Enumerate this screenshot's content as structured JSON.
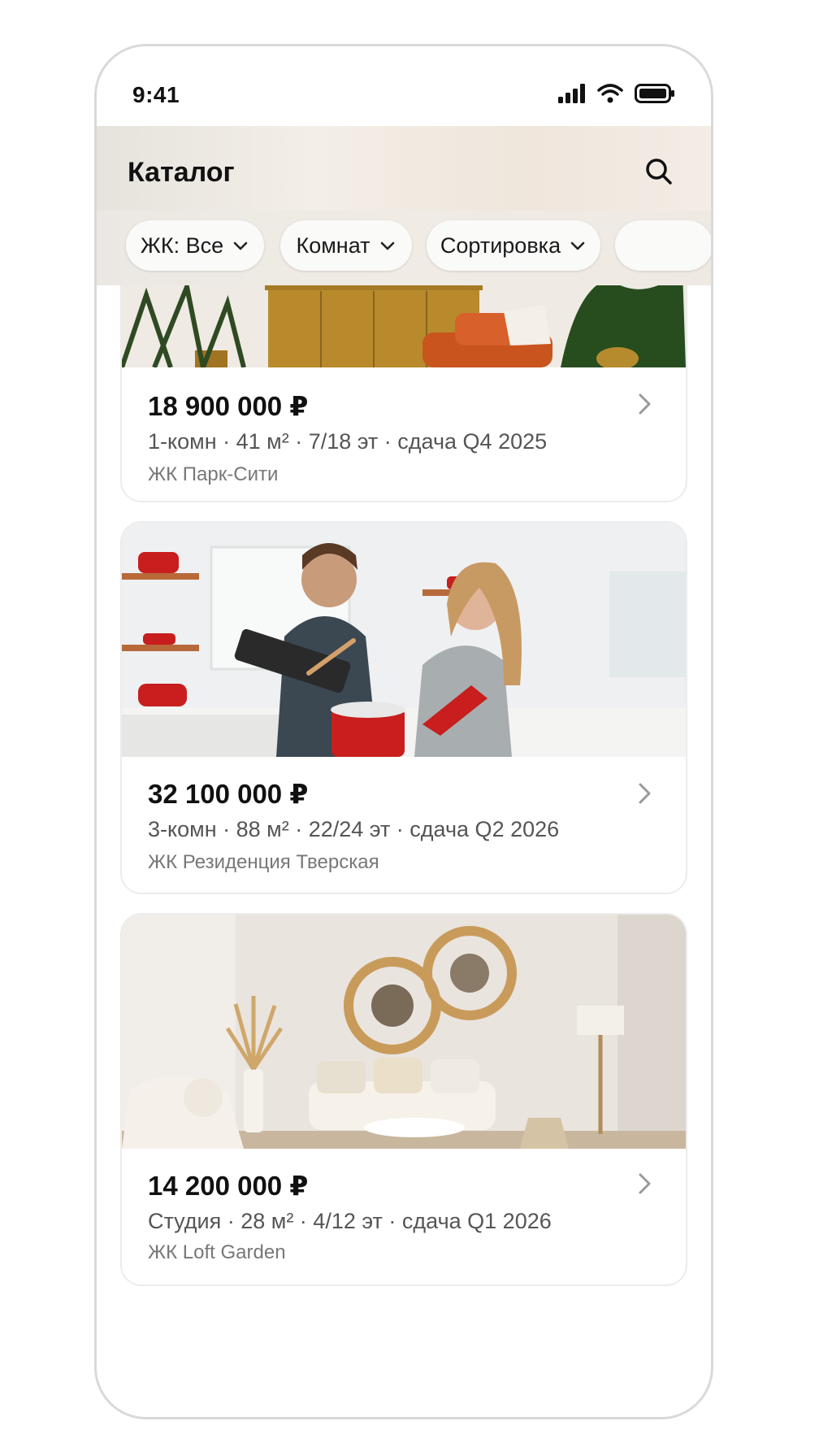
{
  "status": {
    "time": "9:41"
  },
  "header": {
    "title": "Каталог"
  },
  "filters": [
    {
      "label": "ЖК: Все"
    },
    {
      "label": "Комнат"
    },
    {
      "label": "Сортировка"
    }
  ],
  "listings": [
    {
      "price": "18 900 000 ₽",
      "specs": "1-комн · 41 м² · 7/18 эт · сдача Q4 2025",
      "complex": "ЖК Парк-Сити"
    },
    {
      "price": "32 100 000 ₽",
      "specs": "3-комн · 88 м² · 22/24 эт · сдача Q2 2026",
      "complex": "ЖК Резиденция Тверская"
    },
    {
      "price": "14 200 000 ₽",
      "specs": "Студия · 28 м² · 4/12 эт · сдача Q1 2026",
      "complex": "ЖК Loft Garden"
    }
  ],
  "icons": {
    "search": "search-icon",
    "chevron": "chevron-right-icon",
    "dropdown": "chevron-down-icon",
    "signal": "signal-icon",
    "wifi": "wifi-icon",
    "battery": "battery-icon"
  }
}
